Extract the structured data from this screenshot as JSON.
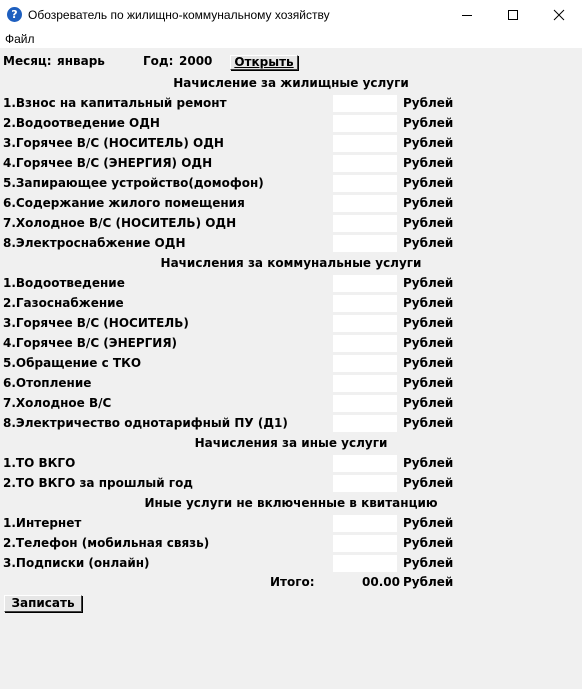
{
  "window": {
    "title": "Обозреватель по жилищно-коммунальному хозяйству",
    "icon": "help-question-icon",
    "controls": [
      "minimize-icon",
      "maximize-icon",
      "close-icon"
    ]
  },
  "menu": {
    "file": "Файл"
  },
  "header": {
    "month_label": "Месяц:",
    "month_value": "январь",
    "year_label": "Год:",
    "year_value": "2000",
    "open_button": "Открыть"
  },
  "currency": "Рублей",
  "sections": [
    {
      "title": "Начисление за жилищные услуги",
      "items": [
        {
          "label": "1.Взнос на капитальный ремонт",
          "value": ""
        },
        {
          "label": "2.Водоотведение ОДН",
          "value": ""
        },
        {
          "label": "3.Горячее В/С (НОСИТЕЛЬ) ОДН",
          "value": ""
        },
        {
          "label": "4.Горячее В/С (ЭНЕРГИЯ) ОДН",
          "value": ""
        },
        {
          "label": "5.Запирающее устройство(домофон)",
          "value": ""
        },
        {
          "label": "6.Содержание жилого помещения",
          "value": ""
        },
        {
          "label": "7.Холодное В/С (НОСИТЕЛЬ) ОДН",
          "value": ""
        },
        {
          "label": "8.Электроснабжение ОДН",
          "value": ""
        }
      ]
    },
    {
      "title": "Начисления за коммунальные услуги",
      "items": [
        {
          "label": "1.Водоотведение",
          "value": ""
        },
        {
          "label": "2.Газоснабжение",
          "value": ""
        },
        {
          "label": "3.Горячее В/С (НОСИТЕЛЬ)",
          "value": ""
        },
        {
          "label": "4.Горячее В/С (ЭНЕРГИЯ)",
          "value": ""
        },
        {
          "label": "5.Обращение с ТКО",
          "value": ""
        },
        {
          "label": "6.Отопление",
          "value": ""
        },
        {
          "label": "7.Холодное В/С",
          "value": ""
        },
        {
          "label": "8.Электричество однотарифный ПУ (Д1)",
          "value": ""
        }
      ]
    },
    {
      "title": "Начисления за иные услуги",
      "items": [
        {
          "label": "1.ТО ВКГО",
          "value": ""
        },
        {
          "label": "2.ТО ВКГО за прошлый год",
          "value": ""
        }
      ]
    },
    {
      "title": "Иные услуги не включенные в квитанцию",
      "items": [
        {
          "label": "1.Интернет",
          "value": ""
        },
        {
          "label": "2.Телефон (мобильная связь)",
          "value": ""
        },
        {
          "label": "3.Подписки (онлайн)",
          "value": ""
        }
      ]
    }
  ],
  "total": {
    "label": "Итого:",
    "value": "00.00",
    "currency": "Рублей"
  },
  "save_button": "Записать"
}
